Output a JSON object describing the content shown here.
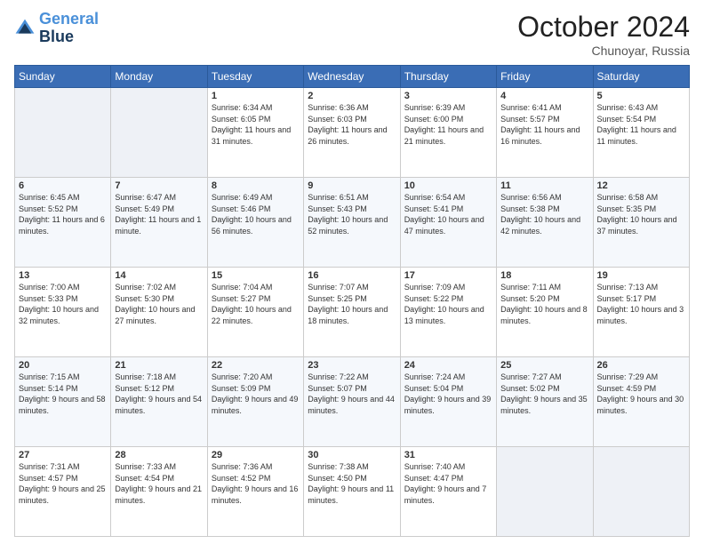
{
  "logo": {
    "line1": "General",
    "line2": "Blue"
  },
  "header": {
    "month": "October 2024",
    "location": "Chunoyar, Russia"
  },
  "days_of_week": [
    "Sunday",
    "Monday",
    "Tuesday",
    "Wednesday",
    "Thursday",
    "Friday",
    "Saturday"
  ],
  "weeks": [
    [
      {
        "day": "",
        "content": ""
      },
      {
        "day": "",
        "content": ""
      },
      {
        "day": "1",
        "content": "Sunrise: 6:34 AM\nSunset: 6:05 PM\nDaylight: 11 hours and 31 minutes."
      },
      {
        "day": "2",
        "content": "Sunrise: 6:36 AM\nSunset: 6:03 PM\nDaylight: 11 hours and 26 minutes."
      },
      {
        "day": "3",
        "content": "Sunrise: 6:39 AM\nSunset: 6:00 PM\nDaylight: 11 hours and 21 minutes."
      },
      {
        "day": "4",
        "content": "Sunrise: 6:41 AM\nSunset: 5:57 PM\nDaylight: 11 hours and 16 minutes."
      },
      {
        "day": "5",
        "content": "Sunrise: 6:43 AM\nSunset: 5:54 PM\nDaylight: 11 hours and 11 minutes."
      }
    ],
    [
      {
        "day": "6",
        "content": "Sunrise: 6:45 AM\nSunset: 5:52 PM\nDaylight: 11 hours and 6 minutes."
      },
      {
        "day": "7",
        "content": "Sunrise: 6:47 AM\nSunset: 5:49 PM\nDaylight: 11 hours and 1 minute."
      },
      {
        "day": "8",
        "content": "Sunrise: 6:49 AM\nSunset: 5:46 PM\nDaylight: 10 hours and 56 minutes."
      },
      {
        "day": "9",
        "content": "Sunrise: 6:51 AM\nSunset: 5:43 PM\nDaylight: 10 hours and 52 minutes."
      },
      {
        "day": "10",
        "content": "Sunrise: 6:54 AM\nSunset: 5:41 PM\nDaylight: 10 hours and 47 minutes."
      },
      {
        "day": "11",
        "content": "Sunrise: 6:56 AM\nSunset: 5:38 PM\nDaylight: 10 hours and 42 minutes."
      },
      {
        "day": "12",
        "content": "Sunrise: 6:58 AM\nSunset: 5:35 PM\nDaylight: 10 hours and 37 minutes."
      }
    ],
    [
      {
        "day": "13",
        "content": "Sunrise: 7:00 AM\nSunset: 5:33 PM\nDaylight: 10 hours and 32 minutes."
      },
      {
        "day": "14",
        "content": "Sunrise: 7:02 AM\nSunset: 5:30 PM\nDaylight: 10 hours and 27 minutes."
      },
      {
        "day": "15",
        "content": "Sunrise: 7:04 AM\nSunset: 5:27 PM\nDaylight: 10 hours and 22 minutes."
      },
      {
        "day": "16",
        "content": "Sunrise: 7:07 AM\nSunset: 5:25 PM\nDaylight: 10 hours and 18 minutes."
      },
      {
        "day": "17",
        "content": "Sunrise: 7:09 AM\nSunset: 5:22 PM\nDaylight: 10 hours and 13 minutes."
      },
      {
        "day": "18",
        "content": "Sunrise: 7:11 AM\nSunset: 5:20 PM\nDaylight: 10 hours and 8 minutes."
      },
      {
        "day": "19",
        "content": "Sunrise: 7:13 AM\nSunset: 5:17 PM\nDaylight: 10 hours and 3 minutes."
      }
    ],
    [
      {
        "day": "20",
        "content": "Sunrise: 7:15 AM\nSunset: 5:14 PM\nDaylight: 9 hours and 58 minutes."
      },
      {
        "day": "21",
        "content": "Sunrise: 7:18 AM\nSunset: 5:12 PM\nDaylight: 9 hours and 54 minutes."
      },
      {
        "day": "22",
        "content": "Sunrise: 7:20 AM\nSunset: 5:09 PM\nDaylight: 9 hours and 49 minutes."
      },
      {
        "day": "23",
        "content": "Sunrise: 7:22 AM\nSunset: 5:07 PM\nDaylight: 9 hours and 44 minutes."
      },
      {
        "day": "24",
        "content": "Sunrise: 7:24 AM\nSunset: 5:04 PM\nDaylight: 9 hours and 39 minutes."
      },
      {
        "day": "25",
        "content": "Sunrise: 7:27 AM\nSunset: 5:02 PM\nDaylight: 9 hours and 35 minutes."
      },
      {
        "day": "26",
        "content": "Sunrise: 7:29 AM\nSunset: 4:59 PM\nDaylight: 9 hours and 30 minutes."
      }
    ],
    [
      {
        "day": "27",
        "content": "Sunrise: 7:31 AM\nSunset: 4:57 PM\nDaylight: 9 hours and 25 minutes."
      },
      {
        "day": "28",
        "content": "Sunrise: 7:33 AM\nSunset: 4:54 PM\nDaylight: 9 hours and 21 minutes."
      },
      {
        "day": "29",
        "content": "Sunrise: 7:36 AM\nSunset: 4:52 PM\nDaylight: 9 hours and 16 minutes."
      },
      {
        "day": "30",
        "content": "Sunrise: 7:38 AM\nSunset: 4:50 PM\nDaylight: 9 hours and 11 minutes."
      },
      {
        "day": "31",
        "content": "Sunrise: 7:40 AM\nSunset: 4:47 PM\nDaylight: 9 hours and 7 minutes."
      },
      {
        "day": "",
        "content": ""
      },
      {
        "day": "",
        "content": ""
      }
    ]
  ]
}
